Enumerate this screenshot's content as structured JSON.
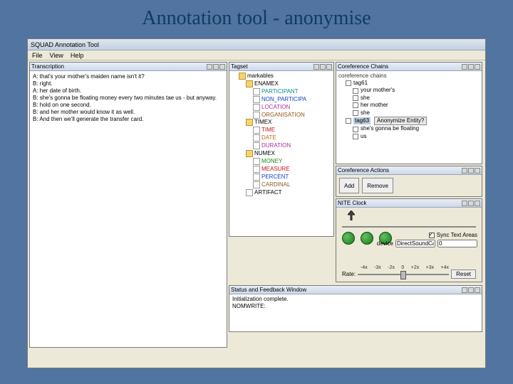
{
  "slide_title": "Annotation tool - anonymise",
  "app_title": "SQUAD Annotation Tool",
  "menu": {
    "file": "File",
    "view": "View",
    "help": "Help"
  },
  "panels": {
    "transcript": {
      "title": "Transcription"
    },
    "tree": {
      "title": "Tagset"
    },
    "chains": {
      "title": "Coreference Chains"
    },
    "actions": {
      "title": "Coreference Actions"
    },
    "clock": {
      "title": "NITE Clock"
    },
    "status": {
      "title": "Status and Feedback Window"
    }
  },
  "transcript": [
    "A: that's your mother's maiden name isn't it?",
    "B: right.",
    "A: her date of birth.",
    "B: she's gonna be floating money every two minutes tae us - but anyway.",
    "B: hold on one second.",
    "B: and her mother would know it as well.",
    "B: And then we'll generate the transfer card."
  ],
  "tree": {
    "root": "markables",
    "enamex": {
      "label": "ENAMEX",
      "items": [
        "PARTICIPANT",
        "NON_PARTICIPA",
        "LOCATION",
        "ORGANISATION"
      ]
    },
    "timex": {
      "label": "TIMEX",
      "items": [
        "TIME",
        "DATE",
        "DURATION"
      ]
    },
    "numex": {
      "label": "NUMEX",
      "items": [
        "MONEY",
        "MEASURE",
        "PERCENT",
        "CARDINAL"
      ]
    },
    "artifact": "ARTIFACT"
  },
  "chains": {
    "header": "coreference chains",
    "group1": {
      "tag": "tag61",
      "items": [
        "your mother's",
        "she",
        "her mother",
        "she"
      ]
    },
    "group2": {
      "tag": "tag63",
      "anonymise_label": "Anonymize Entity?",
      "items": [
        "she's gonna be floating",
        "us"
      ]
    }
  },
  "actions": {
    "add": "Add",
    "remove": "Remove"
  },
  "clock": {
    "sync_label": "Sync Text Areas",
    "device_label": "device",
    "device_value": "DirectSoundCapt",
    "num_value": "0",
    "rate_label": "Rate:",
    "rates": [
      "-4x",
      "-3x",
      "-2x",
      "0",
      "+2x",
      "+3x",
      "+4x"
    ],
    "reset": "Reset"
  },
  "status": {
    "line1": "Initialization complete.",
    "line2": "NOMWRITE:"
  }
}
